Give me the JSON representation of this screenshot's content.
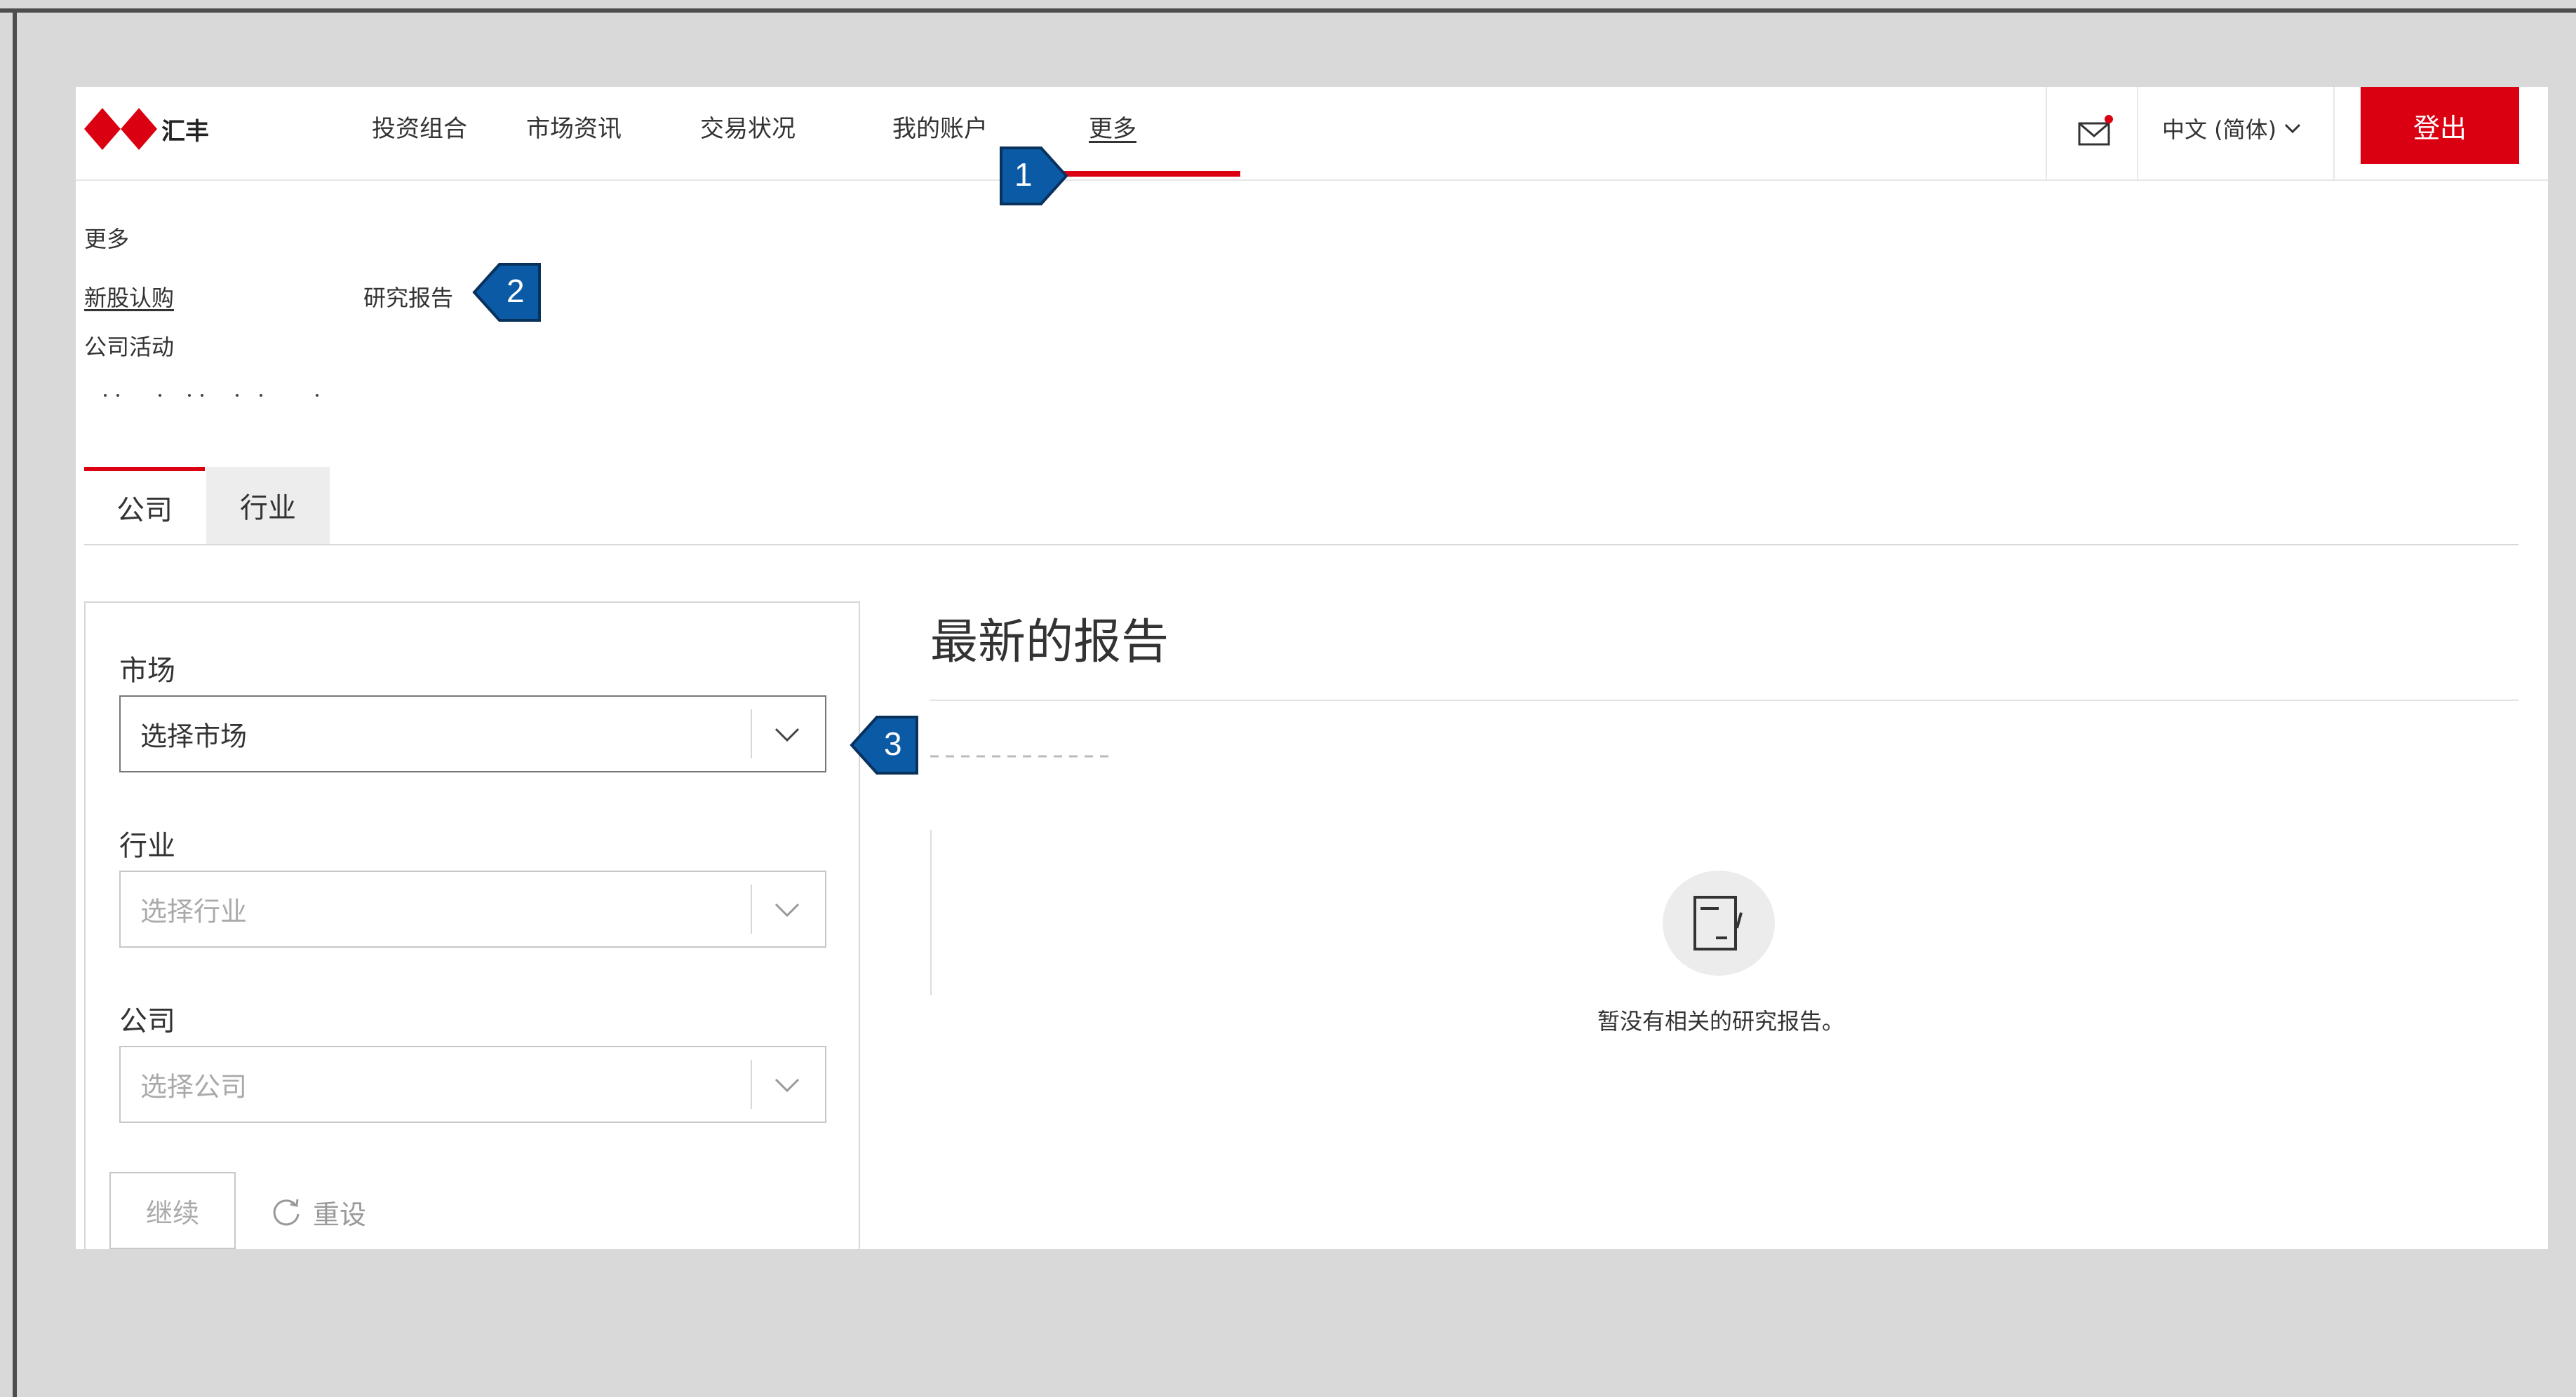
{
  "header": {
    "logo_text": "汇丰",
    "nav": [
      {
        "label": "投资组合"
      },
      {
        "label": "市场资讯"
      },
      {
        "label": "交易状况"
      },
      {
        "label": "我的账户"
      },
      {
        "label": "更多"
      }
    ],
    "language": "中文 (简体)",
    "logout_label": "登出"
  },
  "submenu": {
    "title": "更多",
    "items": [
      {
        "label": "新股认购"
      },
      {
        "label": "研究报告"
      },
      {
        "label": "公司活动"
      }
    ]
  },
  "tabs": [
    {
      "label": "公司"
    },
    {
      "label": "行业"
    }
  ],
  "filters": {
    "market": {
      "label": "市场",
      "value": "选择市场"
    },
    "industry": {
      "label": "行业",
      "value": "选择行业"
    },
    "company": {
      "label": "公司",
      "value": "选择公司"
    },
    "continue_label": "继续",
    "reset_label": "重设"
  },
  "content": {
    "title": "最新的报告",
    "empty_message": "暂没有相关的研究报告。"
  },
  "callouts": [
    {
      "number": "1"
    },
    {
      "number": "2"
    },
    {
      "number": "3"
    }
  ],
  "colors": {
    "brand_red": "#db0011",
    "callout_blue": "#0b5aa6"
  }
}
